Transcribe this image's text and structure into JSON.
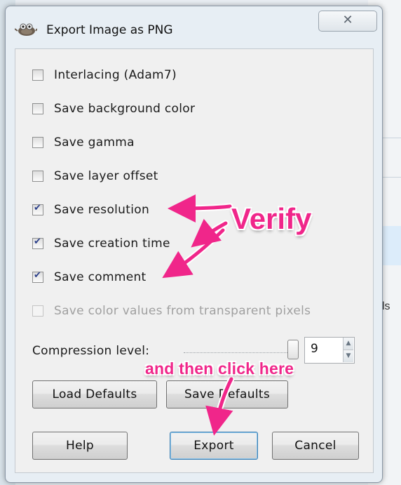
{
  "dialog": {
    "title": "Export Image as PNG",
    "close_glyph": "✕",
    "title_icon": "gimp-icon"
  },
  "options": [
    {
      "label": "Interlacing (Adam7)",
      "checked": false,
      "disabled": false
    },
    {
      "label": "Save background color",
      "checked": false,
      "disabled": false
    },
    {
      "label": "Save gamma",
      "checked": false,
      "disabled": false
    },
    {
      "label": "Save layer offset",
      "checked": false,
      "disabled": false
    },
    {
      "label": "Save resolution",
      "checked": true,
      "disabled": false
    },
    {
      "label": "Save creation time",
      "checked": true,
      "disabled": false
    },
    {
      "label": "Save comment",
      "checked": true,
      "disabled": false
    },
    {
      "label": "Save color values from transparent pixels",
      "checked": false,
      "disabled": true
    }
  ],
  "compression": {
    "label": "Compression level:",
    "value": "9"
  },
  "buttons": {
    "load_defaults": "Load Defaults",
    "save_defaults": "Save Defaults",
    "help": "Help",
    "export": "Export",
    "cancel": "Cancel"
  },
  "annotations": {
    "verify": "Verify",
    "then": "and then click here",
    "color": "#f0268a"
  },
  "background": {
    "right_text": "ls"
  }
}
